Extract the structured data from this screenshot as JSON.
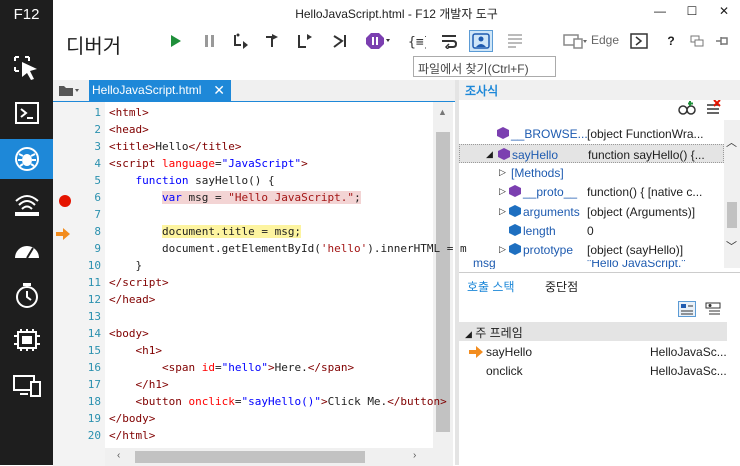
{
  "window": {
    "title": "HelloJavaScript.html - F12 개발자 도구",
    "minimize": "—",
    "maximize": "☐",
    "close": "✕"
  },
  "rail": {
    "label": "F12",
    "items": [
      "dom-explorer",
      "console",
      "debugger",
      "network",
      "performance",
      "memory",
      "emulation",
      "experiments"
    ]
  },
  "toolbar": {
    "tool_name": "디버거",
    "target": "Edge",
    "find_placeholder": "파일에서 찾기(Ctrl+F)",
    "help": "?"
  },
  "editor": {
    "tab_label": "HelloJavaScript.html",
    "lines": [
      {
        "n": "1",
        "html": "<span class='tag'>&lt;html&gt;</span>"
      },
      {
        "n": "2",
        "html": "<span class='tag'>&lt;head&gt;</span>"
      },
      {
        "n": "3",
        "html": "<span class='tag'>&lt;title&gt;</span>Hello<span class='tag'>&lt;/title&gt;</span>"
      },
      {
        "n": "4",
        "html": "<span class='tag'>&lt;script</span> <span class='attr'>language</span>=<span class='kw'>\"JavaScript\"</span><span class='tag'>&gt;</span>"
      },
      {
        "n": "5",
        "html": "    <span class='kw'>function</span> sayHello() {"
      },
      {
        "n": "6",
        "html": "        <span class='hl-bp'><span class='kw'>var</span> msg = <span class='str'>\"Hello JavaScript.\"</span>;</span>"
      },
      {
        "n": "7",
        "html": ""
      },
      {
        "n": "8",
        "html": "        <span class='hl-cur'>document.title = msg;</span>"
      },
      {
        "n": "9",
        "html": "        document.getElementById(<span class='str'>'hello'</span>).innerHTML = m"
      },
      {
        "n": "10",
        "html": "    }"
      },
      {
        "n": "11",
        "html": "<span class='tag'>&lt;/script&gt;</span>"
      },
      {
        "n": "12",
        "html": "<span class='tag'>&lt;/head&gt;</span>"
      },
      {
        "n": "13",
        "html": ""
      },
      {
        "n": "14",
        "html": "<span class='tag'>&lt;body&gt;</span>"
      },
      {
        "n": "15",
        "html": "    <span class='tag'>&lt;h1&gt;</span>"
      },
      {
        "n": "16",
        "html": "        <span class='tag'>&lt;span</span> <span class='attr'>id</span>=<span class='kw'>\"hello\"</span><span class='tag'>&gt;</span>Here.<span class='tag'>&lt;/span&gt;</span>"
      },
      {
        "n": "17",
        "html": "    <span class='tag'>&lt;/h1&gt;</span>"
      },
      {
        "n": "18",
        "html": "    <span class='tag'>&lt;button</span> <span class='attr'>onclick</span>=<span class='kw'>\"sayHello()\"</span><span class='tag'>&gt;</span>Click Me.<span class='tag'>&lt;/button&gt;</span>"
      },
      {
        "n": "19",
        "html": "<span class='tag'>&lt;/body&gt;</span>"
      },
      {
        "n": "20",
        "html": "<span class='tag'>&lt;/html&gt;</span>"
      }
    ]
  },
  "inspector": {
    "title": "조사식",
    "rows": [
      {
        "name": "__BROWSE...",
        "value": "[object FunctionWra..."
      },
      {
        "name": "sayHello",
        "value": "function sayHello() {..."
      },
      {
        "name": "[Methods]",
        "value": ""
      },
      {
        "name": "__proto__",
        "value": "function() { [native c..."
      },
      {
        "name": "arguments",
        "value": "[object (Arguments)]"
      },
      {
        "name": "length",
        "value": "0"
      },
      {
        "name": "prototype",
        "value": "[object (sayHello)]"
      },
      {
        "name": "msg",
        "value": "\"Hello JavaScript.\""
      }
    ]
  },
  "bottom": {
    "tabs": [
      "호출 스택",
      "중단점"
    ],
    "group": "주 프레임",
    "frames": [
      {
        "name": "sayHello",
        "location": "HelloJavaSc..."
      },
      {
        "name": "onclick",
        "location": "HelloJavaSc..."
      }
    ]
  }
}
